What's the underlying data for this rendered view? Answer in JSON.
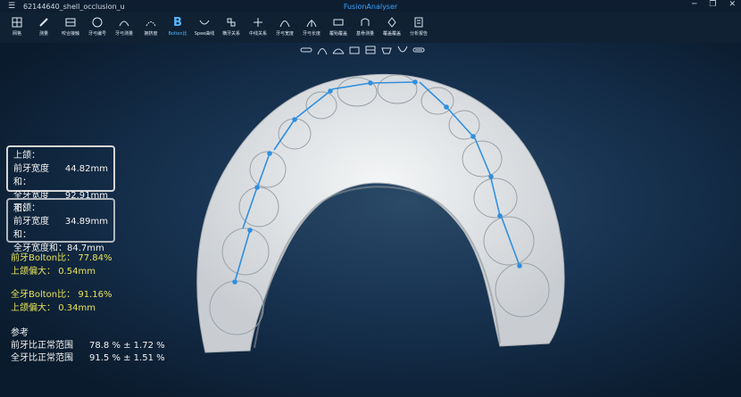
{
  "window": {
    "menu_icon": "hamburger-icon",
    "document_name": "62144640_shell_occlusion_u",
    "app_name": "FusionAnalyser",
    "controls": [
      "minimize",
      "restore",
      "close"
    ]
  },
  "toolbar": {
    "items": [
      {
        "label": "网格",
        "icon": "grid-icon"
      },
      {
        "label": "测量",
        "icon": "pencil-icon"
      },
      {
        "label": "咬合接触",
        "icon": "contact-icon"
      },
      {
        "label": "牙弓编号",
        "icon": "number-icon"
      },
      {
        "label": "牙弓测量",
        "icon": "arch-measure-icon"
      },
      {
        "label": "拥挤度",
        "icon": "crowding-icon"
      },
      {
        "label": "Bolton比",
        "icon": "bolton-icon",
        "active": true
      },
      {
        "label": "Spee曲线",
        "icon": "spee-icon"
      },
      {
        "label": "横牙关系",
        "icon": "relation-icon"
      },
      {
        "label": "中线关系",
        "icon": "midline-icon"
      },
      {
        "label": "牙弓宽度",
        "icon": "arch-width-icon"
      },
      {
        "label": "牙弓长度",
        "icon": "arch-length-icon"
      },
      {
        "label": "覆殆覆盖",
        "icon": "overbite-icon"
      },
      {
        "label": "基骨测量",
        "icon": "basal-bone-icon"
      },
      {
        "label": "覆盖覆盖",
        "icon": "overjet-icon"
      },
      {
        "label": "分析报告",
        "icon": "report-icon"
      }
    ]
  },
  "viewbar": {
    "items": [
      "view-front-icon",
      "view-arch-icon",
      "view-left-icon",
      "view-top-icon",
      "view-right-icon",
      "view-mesh-icon",
      "view-bottom-icon",
      "view-tilt-icon"
    ]
  },
  "results": {
    "upper": {
      "title": "上颌：",
      "anterior_label": "前牙宽度和：",
      "anterior_value": "44.82mm",
      "total_label": "全牙宽度和：",
      "total_value": "92.91mm"
    },
    "lower": {
      "title": "下颌：",
      "anterior_label": "前牙宽度和：",
      "anterior_value": "34.89mm",
      "total_label": "全牙宽度和：",
      "total_value": "84.7mm"
    },
    "anterior_bolton_label": "前牙Bolton比：",
    "anterior_bolton_value": "77.84%",
    "anterior_excess_label": "上颌偏大：",
    "anterior_excess_value": "0.54mm",
    "overall_bolton_label": "全牙Bolton比：",
    "overall_bolton_value": "91.16%",
    "overall_excess_label": "上颌偏大：",
    "overall_excess_value": "0.34mm"
  },
  "reference": {
    "title": "参考",
    "anterior_label": "前牙比正常范围",
    "anterior_value": "78.8 % ± 1.72 %",
    "overall_label": "全牙比正常范围",
    "overall_value": "91.5 % ± 1.51 %"
  },
  "colors": {
    "background": "#0b1a2b",
    "accent": "#3aa3ff",
    "measure_line": "#2f8fe0",
    "highlight_text": "#e8e35a"
  }
}
